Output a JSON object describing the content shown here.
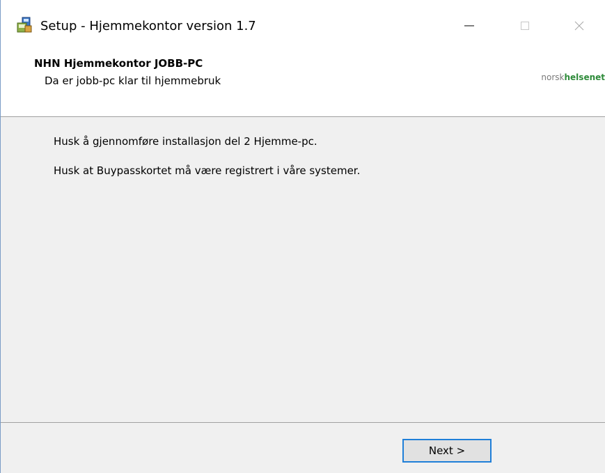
{
  "window": {
    "title": "Setup - Hjemmekontor version 1.7",
    "icon": "setup-installer-icon",
    "controls": {
      "minimize": "minimize-icon",
      "maximize": "maximize-icon",
      "close": "close-icon"
    }
  },
  "header": {
    "title": "NHN Hjemmekontor JOBB-PC",
    "subtitle": "Da er jobb-pc klar til hjemmebruk",
    "logo_part1": "norsk",
    "logo_part2": "helsenet"
  },
  "content": {
    "messages": [
      "Husk å gjennomføre installasjon del 2 Hjemme-pc.",
      "Husk at Buypasskortet må være registrert i våre systemer."
    ]
  },
  "footer": {
    "next_label": "Next >"
  },
  "colors": {
    "accent": "#1f7fd8",
    "panel_bg": "#f0f0f0",
    "logo_green": "#2e8b3a"
  }
}
